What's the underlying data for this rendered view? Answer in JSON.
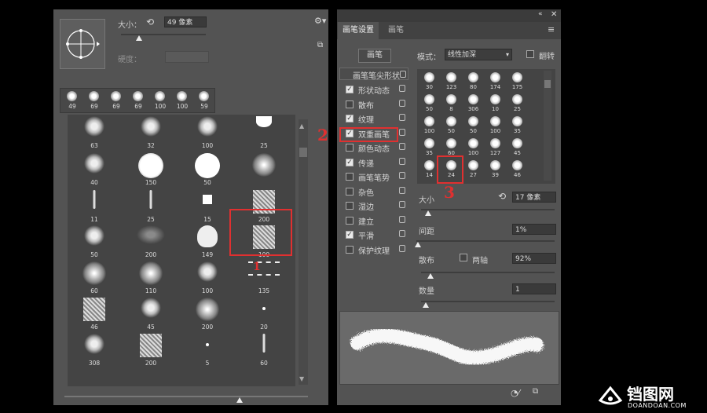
{
  "left": {
    "size_label": "大小：",
    "size_value": "49 像素",
    "hardness_label": "硬度：",
    "recent": [
      "49",
      "69",
      "69",
      "69",
      "100",
      "100",
      "59"
    ],
    "grid_rows": [
      [
        "63",
        "32",
        "100",
        "25"
      ],
      [
        "40",
        "150",
        "50",
        ""
      ],
      [
        "11",
        "25",
        "15",
        "200"
      ],
      [
        "50",
        "200",
        "149",
        "100"
      ],
      [
        "60",
        "110",
        "100",
        "135"
      ],
      [
        "46",
        "45",
        "200",
        "20"
      ],
      [
        "308",
        "200",
        "5",
        "60"
      ]
    ]
  },
  "right": {
    "tab_settings": "画笔设置",
    "tab_brush": "画笔",
    "brush_button": "画笔",
    "mode_label": "模式：",
    "mode_value": "线性加深",
    "flip_label": "翻转",
    "tip_shape_header": "画笔笔尖形状",
    "options": [
      {
        "label": "形状动态",
        "checked": true
      },
      {
        "label": "散布",
        "checked": false
      },
      {
        "label": "纹理",
        "checked": true
      },
      {
        "label": "双重画笔",
        "checked": true
      },
      {
        "label": "颜色动态",
        "checked": false
      },
      {
        "label": "传递",
        "checked": true
      },
      {
        "label": "画笔笔势",
        "checked": false
      },
      {
        "label": "杂色",
        "checked": false
      },
      {
        "label": "湿边",
        "checked": false
      },
      {
        "label": "建立",
        "checked": false
      },
      {
        "label": "平滑",
        "checked": true
      },
      {
        "label": "保护纹理",
        "checked": false
      }
    ],
    "tips": [
      [
        "30",
        "123",
        "80",
        "174",
        "175"
      ],
      [
        "50",
        "8",
        "306",
        "10",
        "25"
      ],
      [
        "100",
        "50",
        "50",
        "100",
        "35"
      ],
      [
        "35",
        "60",
        "100",
        "127",
        "45"
      ],
      [
        "14",
        "24",
        "27",
        "39",
        "46"
      ]
    ],
    "size_label": "大小",
    "size_value": "17 像素",
    "spacing_label": "间距",
    "spacing_value": "1%",
    "scatter_label": "散布",
    "both_axes_label": "两轴",
    "scatter_value": "92%",
    "count_label": "数量",
    "count_value": "1"
  },
  "annotations": {
    "n1": "1",
    "n2": "2",
    "n3": "3"
  },
  "watermark": {
    "name": "铛图网",
    "url": "DOANDOAN.COM"
  },
  "colors": {
    "panel": "#535353",
    "dark": "#444444",
    "red": "#e03030"
  }
}
